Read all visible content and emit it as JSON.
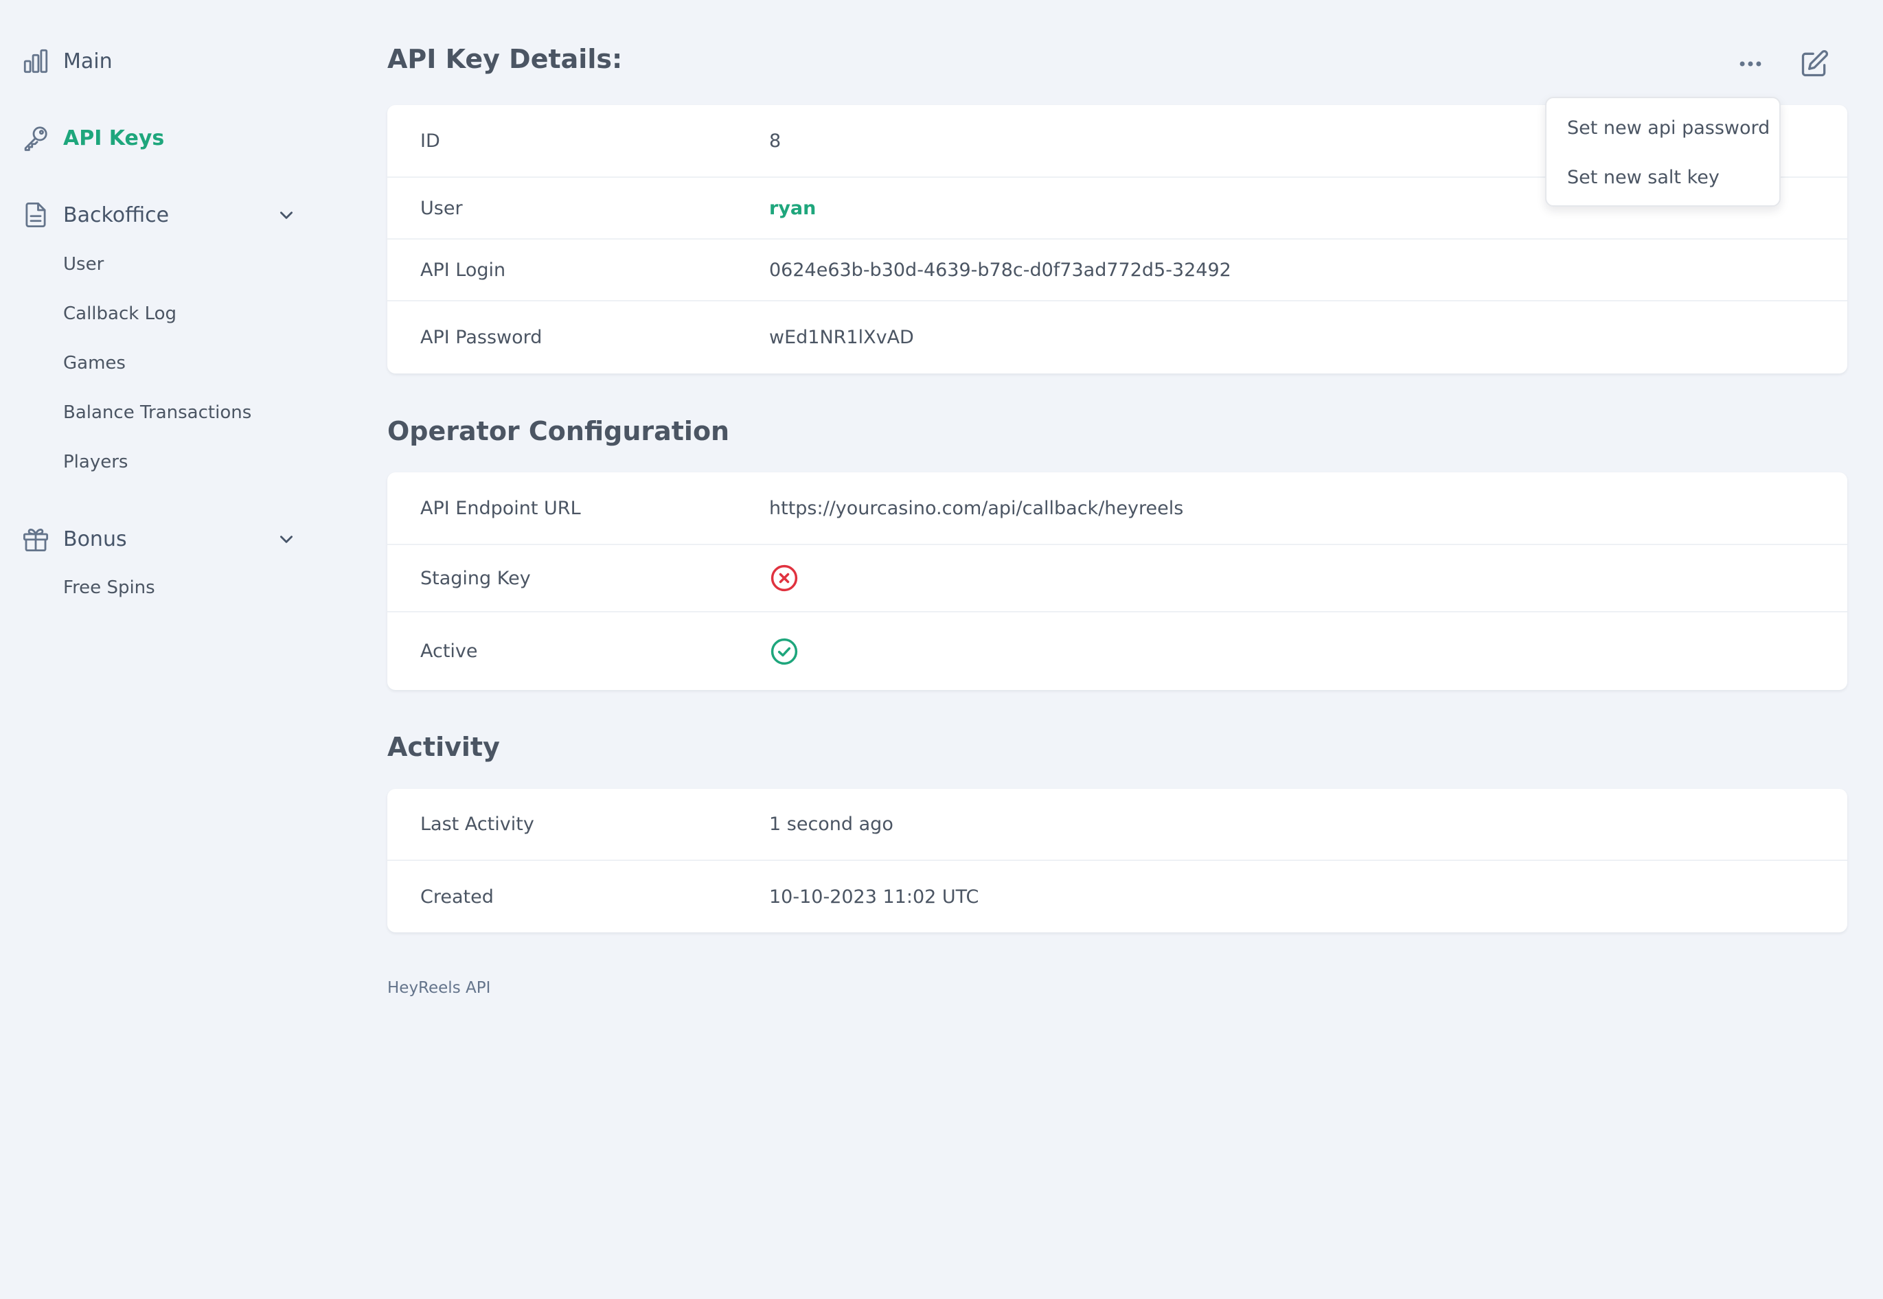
{
  "sidebar": {
    "main": {
      "label": "Main",
      "icon": "bar-chart-icon"
    },
    "api_keys": {
      "label": "API Keys",
      "icon": "key-icon"
    },
    "backoffice": {
      "label": "Backoffice",
      "icon": "document-icon",
      "items": [
        "User",
        "Callback Log",
        "Games",
        "Balance Transactions",
        "Players"
      ]
    },
    "bonus": {
      "label": "Bonus",
      "icon": "gift-icon",
      "items": [
        "Free Spins"
      ]
    }
  },
  "header": {
    "title": "API Key Details:"
  },
  "dropdown": {
    "items": [
      "Set new api password",
      "Set new salt key"
    ]
  },
  "details": {
    "rows": [
      {
        "label": "ID",
        "value": "8"
      },
      {
        "label": "User",
        "value": "ryan"
      },
      {
        "label": "API Login",
        "value": "0624e63b-b30d-4639-b78c-d0f73ad772d5-32492"
      },
      {
        "label": "API Password",
        "value": "wEd1NR1lXvAD"
      }
    ]
  },
  "operator": {
    "title": "Operator Configuration",
    "endpoint_label": "API Endpoint URL",
    "endpoint_value": "https://yourcasino.com/api/callback/heyreels",
    "staging_label": "Staging Key",
    "staging_icon": "x-circle-icon",
    "active_label": "Active",
    "active_icon": "check-circle-icon"
  },
  "activity": {
    "title": "Activity",
    "rows": [
      {
        "label": "Last Activity",
        "value": "1 second ago"
      },
      {
        "label": "Created",
        "value": "10-10-2023 11:02 UTC"
      }
    ]
  },
  "footer": {
    "text": "HeyReels API"
  },
  "colors": {
    "accent": "#1ea67c",
    "error": "#e0323f",
    "background": "#f1f4f9",
    "text": "#475569"
  }
}
